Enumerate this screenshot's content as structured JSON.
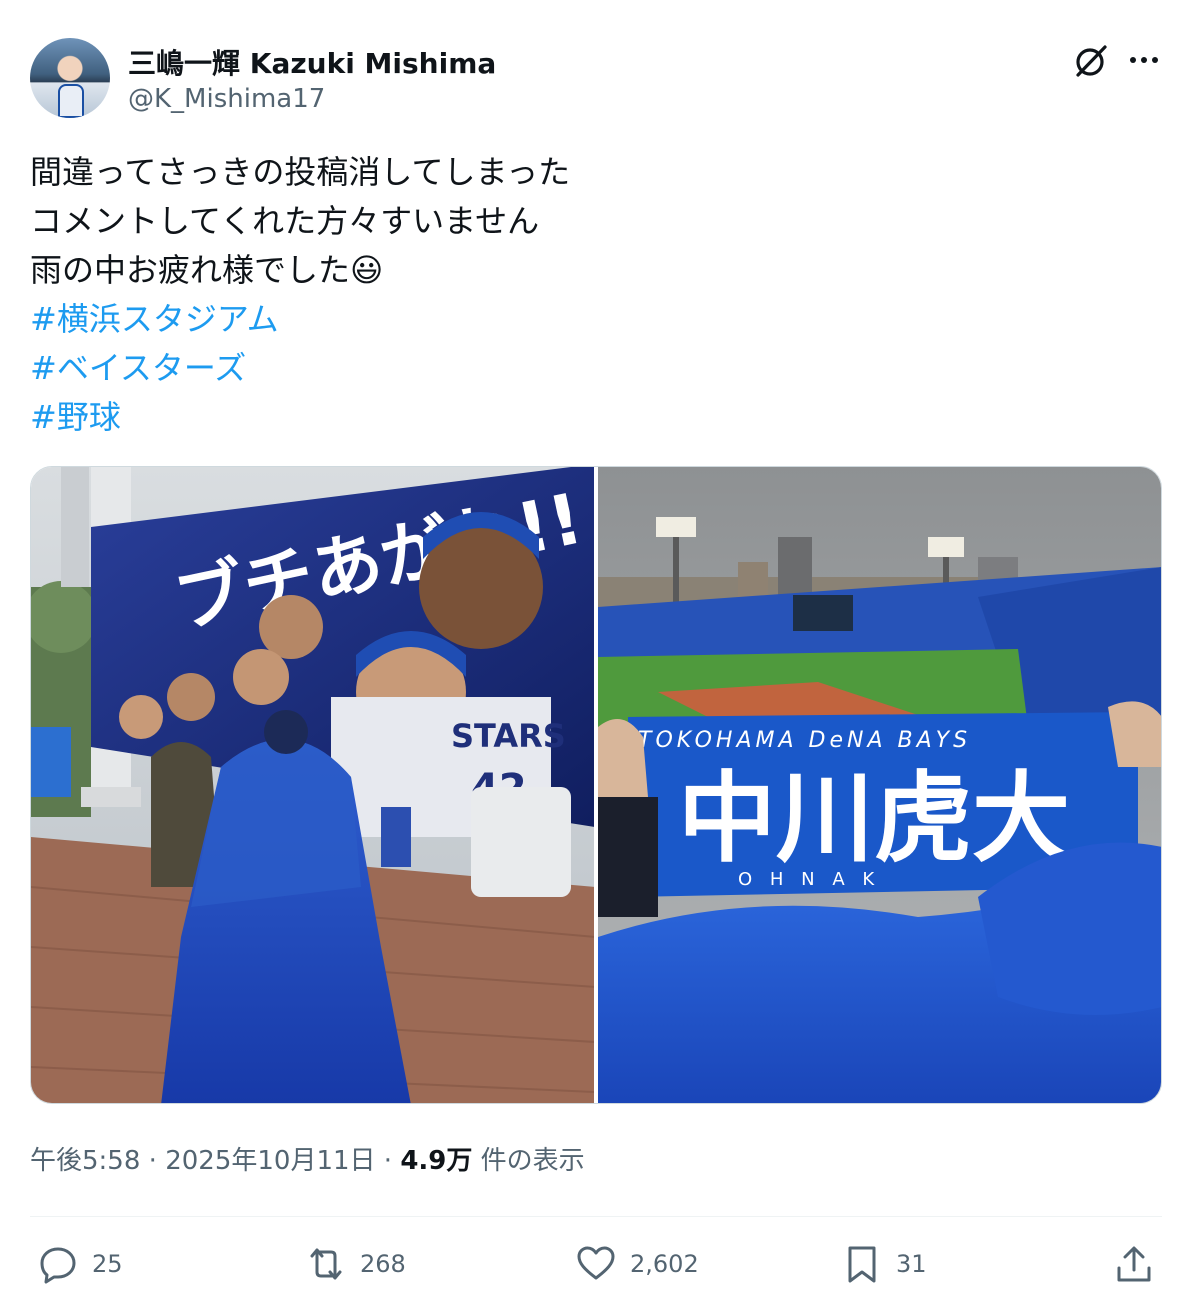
{
  "author": {
    "name": "三嶋一輝 Kazuki Mishima",
    "handle": "@K_Mishima17"
  },
  "header_icons": [
    "grok-icon",
    "more-icon"
  ],
  "post": {
    "lines": [
      "間違ってさっきの投稿消してしまった",
      "コメントしてくれた方々すいません",
      "雨の中お疲れ様でした😃"
    ],
    "hashtags": [
      "#横浜スタジアム",
      "#ベイスターズ",
      "#野球"
    ]
  },
  "media": {
    "left": {
      "banner_text": "ブチあがれ!!",
      "jersey_number": "42",
      "team_text": "STARS"
    },
    "right": {
      "towel_top": "TOKOHAMA DeNA BAYS",
      "towel_name": "中川虎大",
      "towel_bottom": "O H N A K"
    }
  },
  "meta": {
    "time": "午後5:58",
    "sep1": " · ",
    "date": "2025年10月11日",
    "sep2": " · ",
    "views": "4.9万",
    "views_label": " 件の表示"
  },
  "actions": {
    "reply_count": "25",
    "repost_count": "268",
    "like_count": "2,602",
    "bookmark_count": "31"
  },
  "colors": {
    "accent": "#1d9bf0",
    "text": "#0f1419",
    "secondary": "#536471"
  }
}
